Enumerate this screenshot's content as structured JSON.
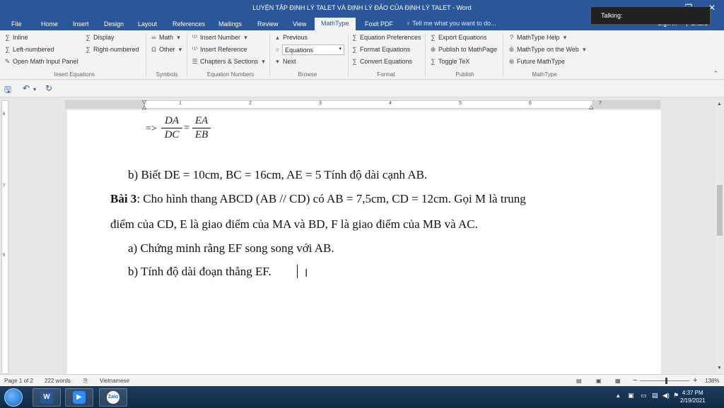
{
  "window": {
    "title": "LUYỆN TẬP ĐỊNH LÝ TALET VÀ ĐỊNH LÝ ĐẢO CỦA ĐỊNH LÝ TALET - Word",
    "talking_label": "Talking:",
    "share_label": "Share"
  },
  "tabs": [
    "File",
    "Home",
    "Insert",
    "Design",
    "Layout",
    "References",
    "Mailings",
    "Review",
    "View",
    "MathType",
    "Foxit PDF"
  ],
  "active_tab": "MathType",
  "tell_me": "Tell me what you want to do...",
  "sign_in": "Sign in",
  "ribbon": {
    "insert_equations": {
      "label": "Insert Equations",
      "inline": "Inline",
      "display": "Display",
      "left_numbered": "Left-numbered",
      "right_numbered": "Right-numbered",
      "open_math_input": "Open Math Input Panel"
    },
    "symbols": {
      "label": "Symbols",
      "math": "Math",
      "other": "Other"
    },
    "equation_numbers": {
      "label": "Equation Numbers",
      "insert_number": "Insert Number",
      "insert_reference": "Insert Reference",
      "chapters_sections": "Chapters & Sections"
    },
    "browse": {
      "label": "Browse",
      "previous": "Previous",
      "next": "Next",
      "dropdown_value": "Equations"
    },
    "format": {
      "label": "Format",
      "equation_preferences": "Equation Preferences",
      "format_equations": "Format Equations",
      "convert_equations": "Convert Equations"
    },
    "publish": {
      "label": "Publish",
      "export_equations": "Export Equations",
      "publish_mathpage": "Publish to MathPage",
      "toggle_tex": "Toggle TeX"
    },
    "mathtype": {
      "label": "MathType",
      "help": "MathType Help",
      "on_web": "MathType on the Web",
      "future": "Future MathType"
    }
  },
  "ruler_numbers": [
    "1",
    "2",
    "3",
    "4",
    "5",
    "6",
    "7"
  ],
  "vruler_numbers": [
    "6",
    "7",
    "8"
  ],
  "document": {
    "frac_prefix": "=>",
    "frac1_num": "DA",
    "frac1_den": "DC",
    "equals": "=",
    "frac2_num": "EA",
    "frac2_den": "EB",
    "line_b1": "b)  Biết DE = 10cm, BC = 16cm, AE = 5 Tính độ dài cạnh AB.",
    "bai3_label": "Bài 3",
    "bai3_text": ": Cho hình thang ABCD (AB // CD) có  AB = 7,5cm, CD = 12cm.  Gọi M là trung",
    "bai3_text2": "điểm của CD, E là giao điểm của MA và BD, F là giao điểm của MB và AC.",
    "item_a": "a)  Chứng minh rằng EF song song với AB.",
    "item_b": "b)  Tính độ dài đoạn thẳng EF."
  },
  "status": {
    "page": "Page 1 of 2",
    "words": "222 words",
    "language": "Vietnamese",
    "zoom": "138%"
  },
  "taskbar": {
    "time": "4:37 PM",
    "date": "2/19/2021"
  },
  "colors": {
    "word_blue": "#2b579a",
    "ribbon_bg": "#f3f3f3"
  }
}
